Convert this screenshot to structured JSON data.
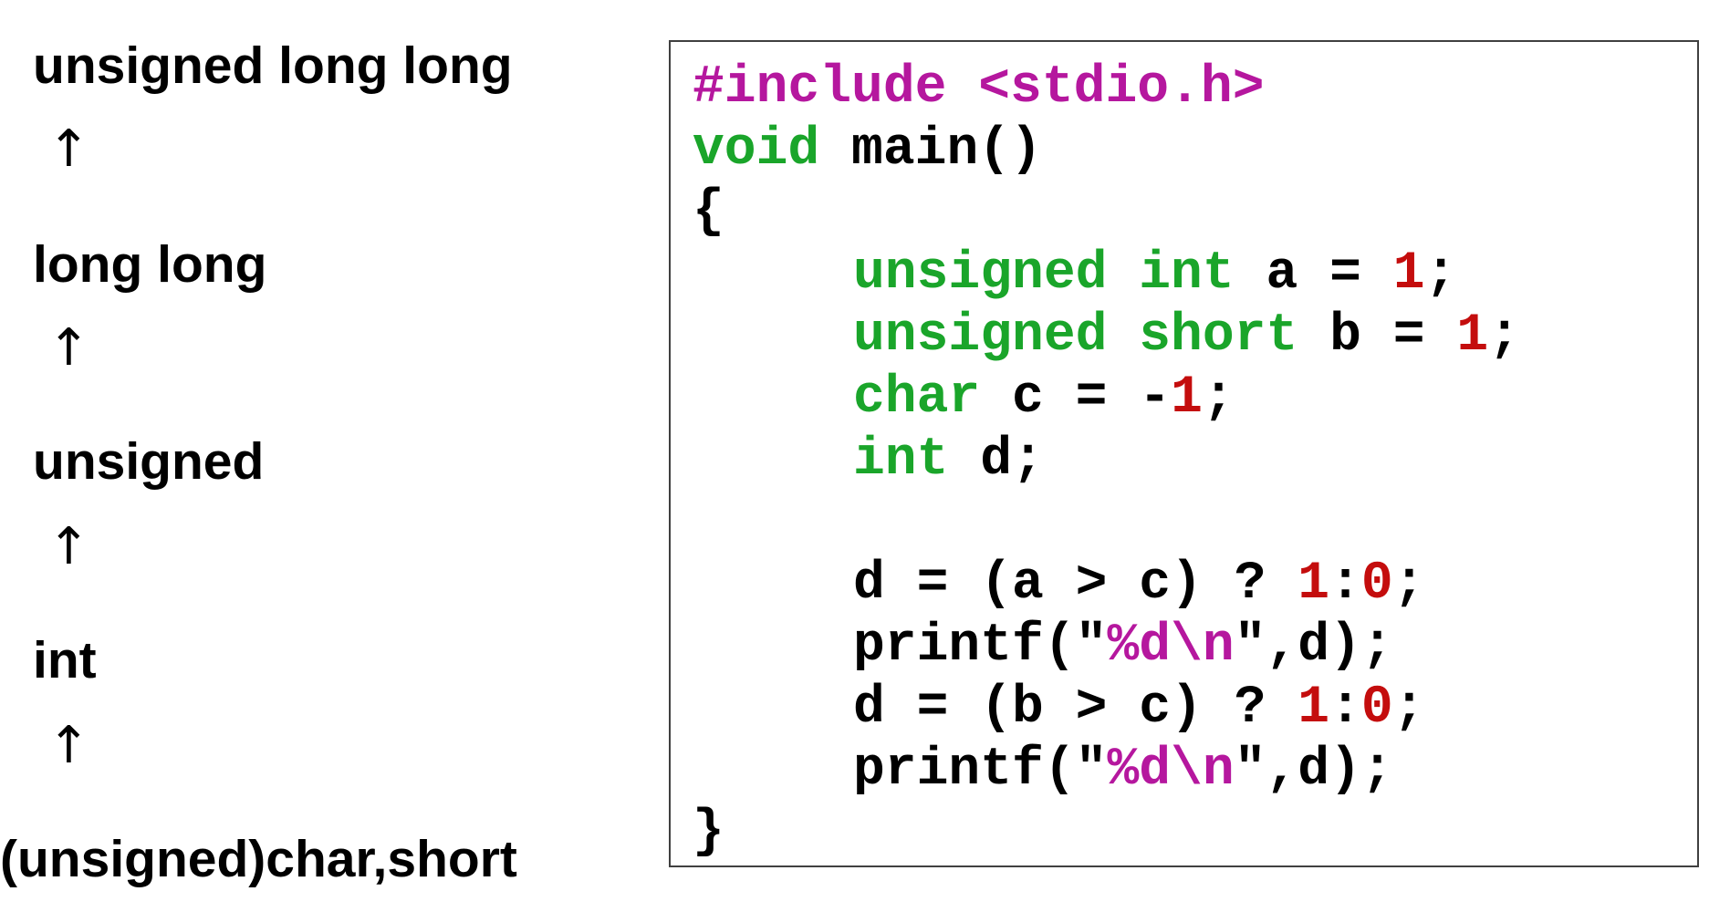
{
  "hierarchy": {
    "items": [
      "unsigned long long",
      "long long",
      "unsigned",
      "int",
      "(unsigned)char,short"
    ],
    "arrow": "↑"
  },
  "code": {
    "lines": [
      [
        {
          "t": "#include <stdio.h>",
          "k": "pp"
        }
      ],
      [
        {
          "t": "void",
          "k": "kw"
        },
        {
          "t": " main()",
          "k": "plain"
        }
      ],
      [
        {
          "t": "{",
          "k": "plain"
        }
      ],
      [
        {
          "t": "unsigned int",
          "k": "kw"
        },
        {
          "t": " a = ",
          "k": "plain"
        },
        {
          "t": "1",
          "k": "num"
        },
        {
          "t": ";",
          "k": "plain"
        }
      ],
      [
        {
          "t": "unsigned short",
          "k": "kw"
        },
        {
          "t": " b = ",
          "k": "plain"
        },
        {
          "t": "1",
          "k": "num"
        },
        {
          "t": ";",
          "k": "plain"
        }
      ],
      [
        {
          "t": "char",
          "k": "kw"
        },
        {
          "t": " c = -",
          "k": "plain"
        },
        {
          "t": "1",
          "k": "num"
        },
        {
          "t": ";",
          "k": "plain"
        }
      ],
      [
        {
          "t": "int",
          "k": "kw"
        },
        {
          "t": " d;",
          "k": "plain"
        }
      ],
      [],
      [
        {
          "t": "d = (a > c) ? ",
          "k": "plain"
        },
        {
          "t": "1",
          "k": "num"
        },
        {
          "t": ":",
          "k": "plain"
        },
        {
          "t": "0",
          "k": "num"
        },
        {
          "t": ";",
          "k": "plain"
        }
      ],
      [
        {
          "t": "printf(\"",
          "k": "plain"
        },
        {
          "t": "%d\\n",
          "k": "str"
        },
        {
          "t": "\",d);",
          "k": "plain"
        }
      ],
      [
        {
          "t": "d = (b > c) ? ",
          "k": "plain"
        },
        {
          "t": "1",
          "k": "num"
        },
        {
          "t": ":",
          "k": "plain"
        },
        {
          "t": "0",
          "k": "num"
        },
        {
          "t": ";",
          "k": "plain"
        }
      ],
      [
        {
          "t": "printf(\"",
          "k": "plain"
        },
        {
          "t": "%d\\n",
          "k": "str"
        },
        {
          "t": "\",d);",
          "k": "plain"
        }
      ],
      [
        {
          "t": "}",
          "k": "plain"
        }
      ]
    ]
  },
  "colors": {
    "preprocessor": "#b5179e",
    "keyword": "#1aa52a",
    "number": "#c40d0d",
    "string": "#b5179e",
    "text": "#000000"
  }
}
